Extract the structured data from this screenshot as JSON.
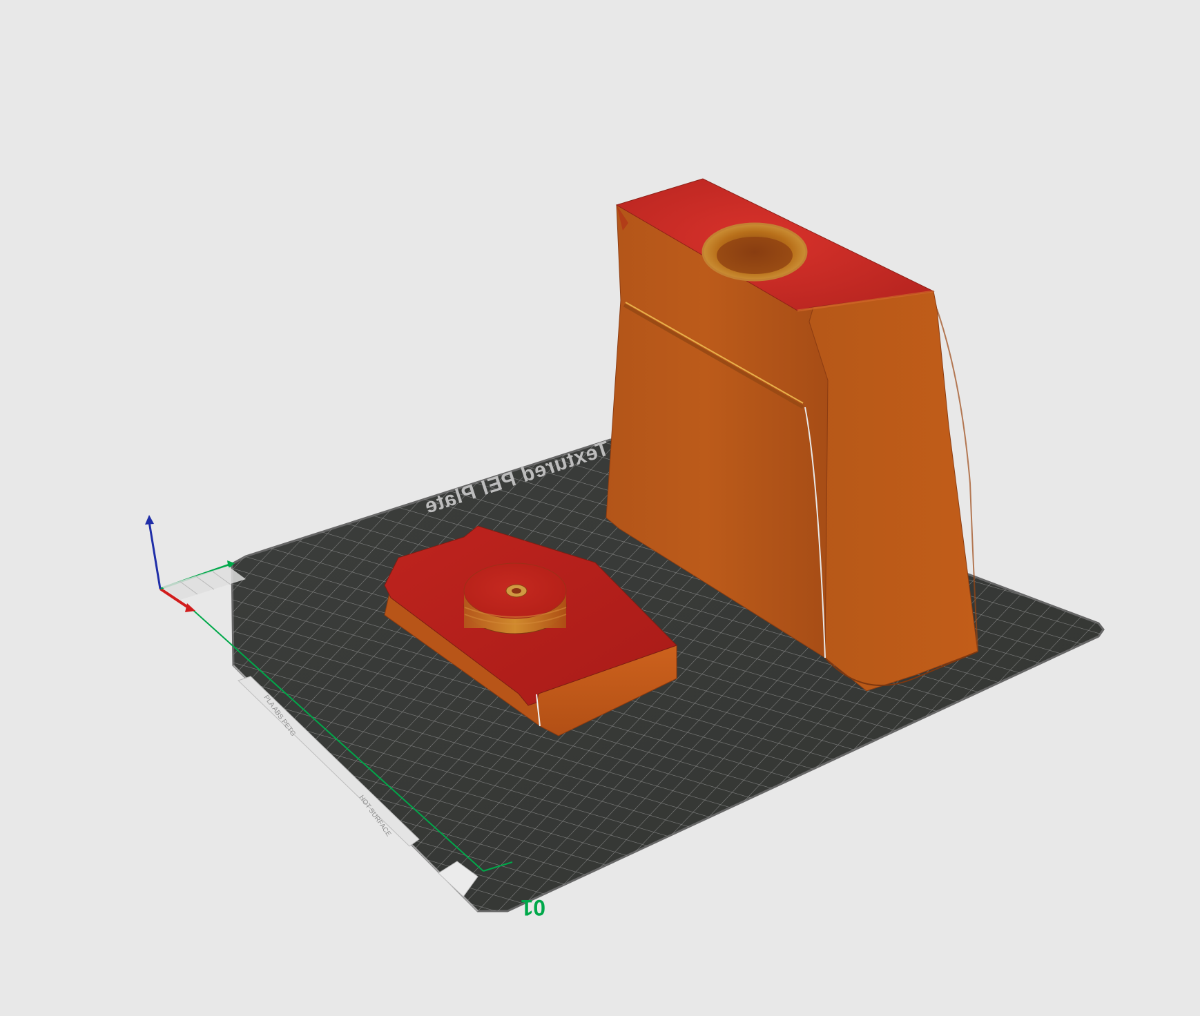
{
  "viewport": {
    "background_color": "#e8e8e8"
  },
  "build_plate": {
    "label": "Textured PEI Plate",
    "plate_number": "01",
    "surface_color": "#3b3d3b",
    "grid_color": "#9a9a9a",
    "edge_color": "#666666",
    "sticker_text": "PLA ABS PETG",
    "sticker_text_2": "HOT SURFACE",
    "number_color": "#00a84a"
  },
  "axes": {
    "x_color": "#d11c1c",
    "y_color": "#00a84a",
    "z_color": "#1f2ea8"
  },
  "objects": [
    {
      "name": "flat-part",
      "top_color": "#b51f1b",
      "side_color": "#c35b1a"
    },
    {
      "name": "tall-box",
      "top_color": "#c42a22",
      "side_color": "#b75319"
    }
  ]
}
